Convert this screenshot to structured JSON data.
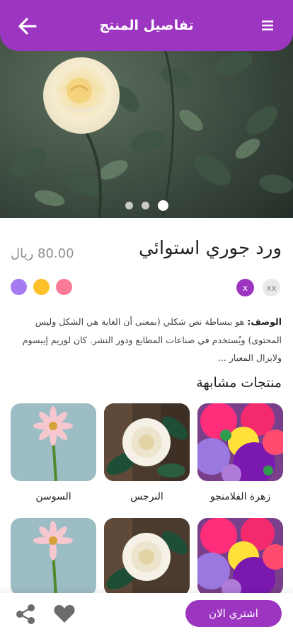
{
  "header": {
    "title": "تفاصيل المنتج",
    "back_icon": "arrow-left-icon",
    "menu_icon": "hamburger-menu-icon",
    "background": "#9c35c0"
  },
  "hero": {
    "image": "white-rose-photo",
    "slide_count": 3,
    "active_slide": 1
  },
  "product": {
    "name": "ورد جوري استوائي",
    "price": "80.00 ريال",
    "colors": [
      "#a77bf0",
      "#fec12a",
      "#fa7b97"
    ],
    "sizes": [
      {
        "label": "xx",
        "selected": false
      },
      {
        "label": "x",
        "selected": true
      }
    ],
    "description_label": "الوصف:",
    "description_text": " هو ببساطة نص شكلي (بمعنى أن الغاية هي الشكل وليس المحتوى) ويُستخدم في صناعات المطابع ودور  النشر. كان لوريم إيبسوم ولايزال المعيار ..."
  },
  "similar": {
    "title": "منتجات مشابهة",
    "items": [
      {
        "name": "زهرة الفلامنجو",
        "image": "paper-flowers-photo"
      },
      {
        "name": "النرجس",
        "image": "white-rose-photo"
      },
      {
        "name": "السوسن",
        "image": "pink-gerbera-photo"
      },
      {
        "name": "",
        "image": "paper-flowers-photo"
      },
      {
        "name": "",
        "image": "white-rose-photo"
      },
      {
        "name": "",
        "image": "pink-gerbera-photo"
      }
    ]
  },
  "bottom_bar": {
    "buy_label": "اشتري الان",
    "share_icon": "share-icon",
    "favorite_icon": "heart-icon"
  }
}
